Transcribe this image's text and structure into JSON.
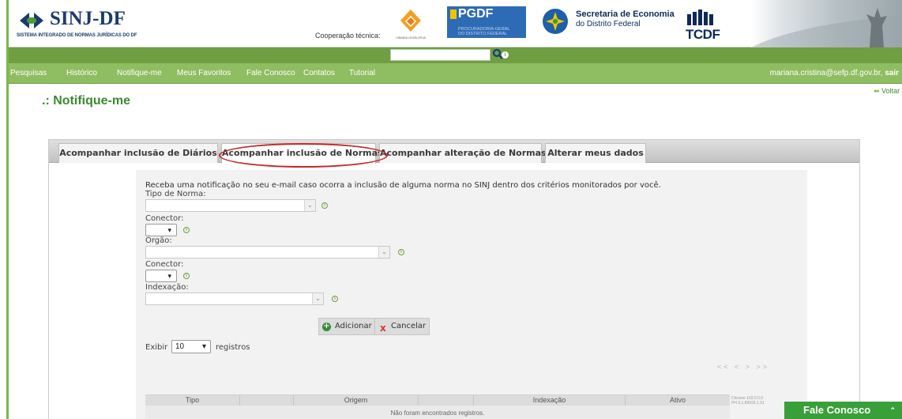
{
  "header": {
    "logo_title": "SINJ-DF",
    "logo_subtitle": "SISTEMA INTEGRADO DE NORMAS JURÍDICAS DO DF",
    "cooperation_label": "Cooperação técnica:",
    "camara_label": "CÂMARA LEGISLATIVA",
    "pgdf_title": "PGDF",
    "pgdf_subtitle_1": "PROCURADORIA-GERAL",
    "pgdf_subtitle_2": "DO DISTRITO FEDERAL",
    "seec_title": "Secretaria de Economia",
    "seec_subtitle": "do Distrito Federal",
    "tcdf_label": "TCDF"
  },
  "search": {
    "value": "",
    "placeholder": "",
    "button_icon": "search-icon",
    "info_icon": "info-icon"
  },
  "nav": {
    "items": [
      "Pesquisas",
      "Histórico",
      "Notifique-me",
      "Meus Favoritos",
      "Fale Conosco",
      "Contatos",
      "Tutorial"
    ],
    "user_email": "mariana.cristina@sefp.df.gov.br,",
    "logout_label": "sair"
  },
  "page": {
    "title": ".: Notifique-me",
    "back_label": "Voltar"
  },
  "tabs": [
    {
      "label": "Acompanhar inclusão de Diários",
      "active": false
    },
    {
      "label": "Acompanhar inclusão de Normas",
      "active": true
    },
    {
      "label": "Acompanhar alteração de Normas",
      "active": false
    },
    {
      "label": "Alterar meus dados",
      "active": false
    }
  ],
  "form": {
    "intro": "Receba uma notificação no seu e-mail caso ocorra a inclusão de alguma norma no SINJ dentro dos critérios monitorados por você.",
    "tipo_label": "Tipo de Norma:",
    "tipo_value": "",
    "connector1_label": "Conector:",
    "connector1_value": "",
    "orgao_label": "Órgão:",
    "orgao_value": "",
    "connector2_label": "Conector:",
    "connector2_value": "",
    "indexacao_label": "Indexação:",
    "indexacao_value": "",
    "add_label": "Adicionar",
    "cancel_label": "Cancelar"
  },
  "table": {
    "exibir_label": "Exibir",
    "page_size": "10",
    "registros_label": "registros",
    "pager": "<< < > >>",
    "columns": [
      "Tipo",
      "",
      "Origem",
      "",
      "Indexação",
      "Ativo"
    ],
    "empty_message": "Não foram encontrados registros.",
    "version_1": "Chrome 103.0.0.0",
    "version_2": "PH 3.1.89933.1.91"
  },
  "floating": {
    "contact_label": "Fale Conosco"
  },
  "colors": {
    "brand_green": "#6f9e43",
    "nav_green": "#8fbd61",
    "title_green": "#3b8a2f",
    "highlight_red": "#c62828"
  }
}
